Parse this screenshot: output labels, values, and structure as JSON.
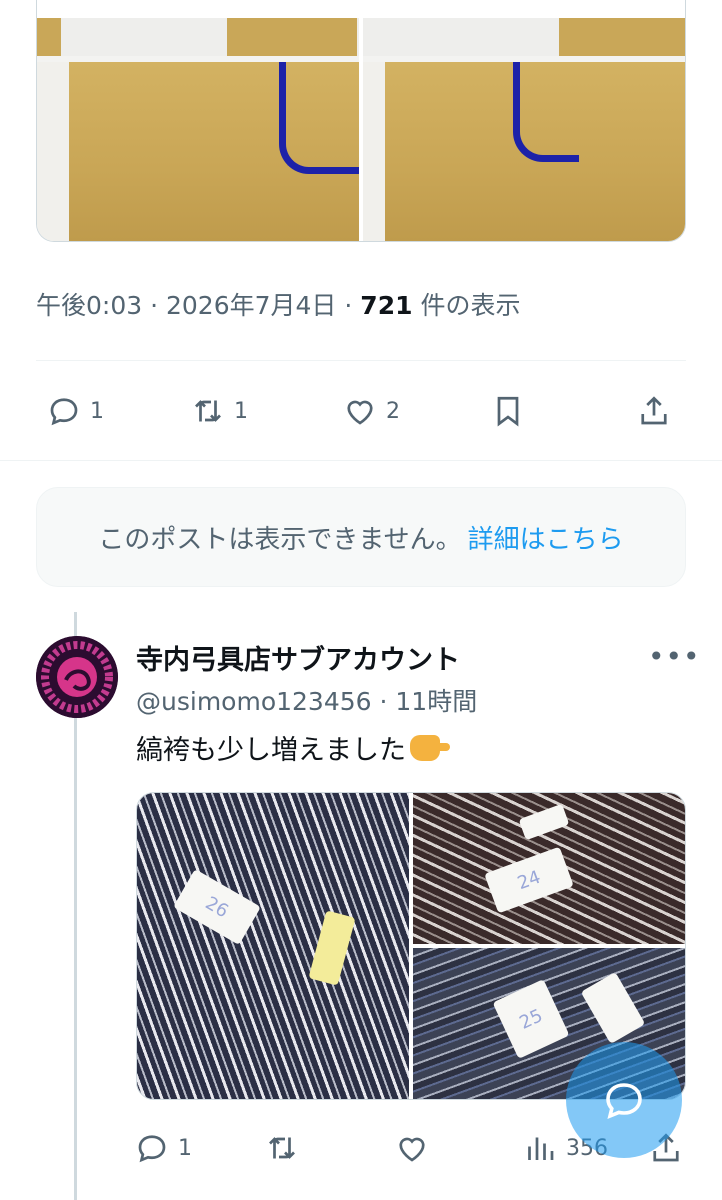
{
  "post": {
    "time": "午後0:03",
    "date": "2026年7月4日",
    "sep": "·",
    "views_count": "721",
    "views_label": "件の表示",
    "actions": {
      "reply_count": "1",
      "repost_count": "1",
      "like_count": "2"
    }
  },
  "unavailable": {
    "message": "このポストは表示できません。",
    "link": "詳細はこちら"
  },
  "reply": {
    "name": "寺内弓具店サブアカウント",
    "handle": "@usimomo123456",
    "sep": "·",
    "age": "11時間",
    "more": "•••",
    "text": "縞袴も少し増えました",
    "actions": {
      "reply_count": "1",
      "views_count": "356"
    },
    "media_tags": [
      "26",
      "24",
      "25"
    ]
  },
  "colors": {
    "accent": "#1d9bf0",
    "secondary_text": "#536471",
    "primary_text": "#0f1419",
    "border": "#cfd9de"
  }
}
